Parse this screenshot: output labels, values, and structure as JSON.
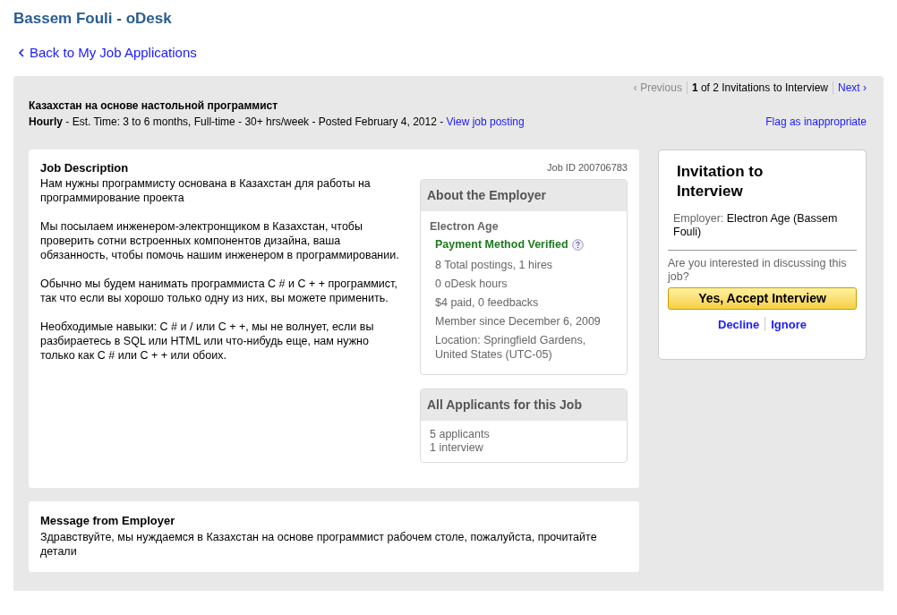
{
  "page_title": "Bassem Fouli - oDesk",
  "back_link": "Back to My Job Applications",
  "pager": {
    "previous": {
      "label": "‹ Previous",
      "disabled": true
    },
    "position": "**1** of 2 Invitations to Interview",
    "next": {
      "label": "Next ›",
      "disabled": false
    }
  },
  "job": {
    "title": "Казахстан на основе настольной программист",
    "summary": "**Hourly** - Est. Time: 3 to 6 months, Full-time - 30+ hrs/week - Posted February 4, 2012 - ",
    "view_link": "View job posting",
    "flag_link": "Flag as inappropriate"
  },
  "description": {
    "heading": "Job Description",
    "job_id": "Job ID 200706783",
    "paragraphs": [
      "Нам нужны программисту основана в Казахстан для работы на программирование проекта",
      "Мы посылаем инженером-электронщиком в Казахстан, чтобы проверить сотни встроенных компонентов дизайна, ваша обязанность, чтобы помочь нашим инженером в программировании.",
      "Обычно мы будем нанимать программиста C # и C + + программист, так что если вы хорошо только одну из них, вы можете применить.",
      "Необходимые навыки: C # и / или C + +, мы не волнует, если вы разбираетесь в SQL или HTML или что-нибудь еще, нам нужно только как C # или C + + или обоих."
    ]
  },
  "employer": {
    "heading": "About the Employer",
    "name": "Electron Age",
    "payment_verified": true,
    "verified_label": "Payment Method Verified",
    "stats": [
      "8 Total postings, 1 hires",
      "0 oDesk hours",
      "$4 paid, 0 feedbacks",
      "Member since December 6, 2009",
      "Location: Springfield Gardens, United States (UTC-05)"
    ]
  },
  "applicants": {
    "heading": "All Applicants for this Job",
    "lines": [
      "5 applicants",
      "1 interview"
    ]
  },
  "invitation": {
    "heading": "Invitation to Interview",
    "employer_label": "Employer:",
    "employer_value": "Electron Age (Bassem Fouli)",
    "question": "Are you interested in discussing this job?",
    "accept": "Yes, Accept Interview",
    "decline": "Decline",
    "ignore": "Ignore"
  },
  "message": {
    "heading": "Message from Employer",
    "text": "Здравствуйте, мы нуждаемся в Казахстан на основе программист рабочем столе, пожалуйста, прочитайте детали"
  }
}
